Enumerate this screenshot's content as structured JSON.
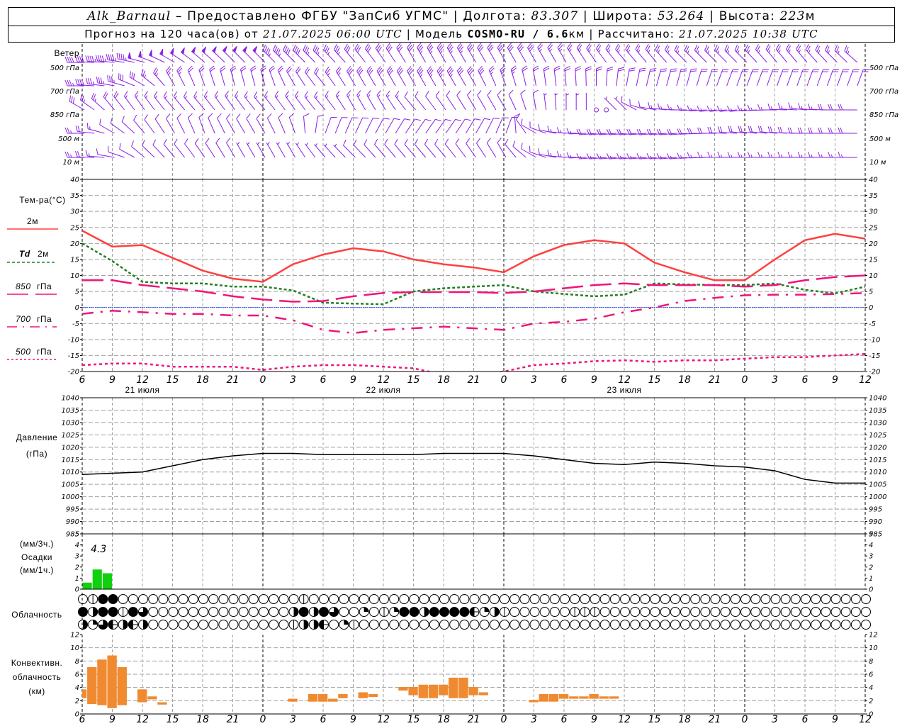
{
  "header": {
    "station": "Alk_Barnaul",
    "dash": "–",
    "provider": "Предоставлено ФГБУ \"ЗапСиб УГМС\"",
    "lon_label": "Долгота:",
    "lon": "83.307",
    "lat_label": "Широта:",
    "lat": "53.264",
    "alt_label": "Высота:",
    "alt": "223",
    "alt_unit": "м",
    "forecast_label": "Прогноз на 120 часа(ов) от",
    "forecast_start": "21.07.2025 06:00 UTC",
    "model_label": "Модель",
    "model": "COSMO-RU / 6.6",
    "model_unit": "км",
    "calc_label": "Рассчитано:",
    "calc_time": "21.07.2025 10:38 UTC",
    "sep": "|"
  },
  "labels": {
    "wind": "Ветер",
    "levels": [
      "500 гПа",
      "700 гПа",
      "850 гПа",
      "500 м",
      "10  м"
    ],
    "temp_title": "Тем-ра(°C)",
    "t2m": "2м",
    "td": "Td",
    "td_2m": "2м",
    "t850": "850",
    "t700": "700",
    "t500": "500",
    "gpa": "гПа",
    "pressure1": "Давление",
    "pressure2": "(гПа)",
    "precip1": "(мм/3ч.)",
    "precip2": "Осадки",
    "precip3": "(мм/1ч.)",
    "cloud": "Облачность",
    "conv1": "Конвективн.",
    "conv2": "облачность",
    "conv3": "(км)"
  },
  "colors": {
    "t2m": "#ff4040",
    "td": "#208020",
    "levels": "#f0147a",
    "zero": "#3050ff",
    "wind": "#8a1ee6",
    "precip": "#10d010",
    "conv": "#f08a30",
    "pressure": "#000000"
  },
  "axis": {
    "hour_ticks": [
      "6",
      "9",
      "12",
      "15",
      "18",
      "21",
      "0",
      "3",
      "6",
      "9",
      "12",
      "15",
      "18",
      "21",
      "0",
      "3",
      "6",
      "9",
      "12",
      "15",
      "18",
      "21",
      "0",
      "3",
      "6",
      "9",
      "12"
    ],
    "days": [
      "21 июля",
      "22 июля",
      "23 июля"
    ]
  },
  "chart_data": [
    {
      "type": "line",
      "title": "Тем-ра(°C)",
      "ylim": [
        -20,
        40
      ],
      "yticks": [
        "40",
        "35",
        "30",
        "25",
        "20",
        "15",
        "10",
        "5",
        "0",
        "-5",
        "-10",
        "-15",
        "-20"
      ],
      "grid": true,
      "times": [
        "21.07 06",
        "21.07 09",
        "21.07 12",
        "21.07 15",
        "21.07 18",
        "21.07 21",
        "22.07 00",
        "22.07 03",
        "22.07 06",
        "22.07 09",
        "22.07 12",
        "22.07 15",
        "22.07 18",
        "22.07 21",
        "23.07 00",
        "23.07 03",
        "23.07 06",
        "23.07 09",
        "23.07 12",
        "23.07 15",
        "23.07 18",
        "23.07 21",
        "24.07 00",
        "24.07 03",
        "24.07 06",
        "24.07 09",
        "24.07 12"
      ],
      "series": [
        {
          "name": "2м",
          "key": "t2m",
          "values": [
            24,
            19,
            19.5,
            15.5,
            11.5,
            9,
            8,
            13.5,
            16.5,
            18.5,
            17.5,
            15,
            13.5,
            12.5,
            11,
            16,
            19.5,
            21,
            20,
            14,
            11,
            8.5,
            8.5,
            15,
            21,
            23,
            21.5
          ]
        },
        {
          "name": "Td 2м",
          "key": "td",
          "values": [
            20,
            14.5,
            8,
            7.5,
            7.5,
            6.5,
            6.5,
            5.3,
            1.5,
            1.2,
            1,
            5,
            6,
            6.5,
            7,
            5,
            4.2,
            3.5,
            4,
            7.5,
            7.2,
            7,
            7,
            7.5,
            5.5,
            4.4,
            6.5
          ]
        },
        {
          "name": "850 гПа",
          "key": "t850",
          "values": [
            8.5,
            8.5,
            7,
            6,
            5,
            3.5,
            2.5,
            1.8,
            2,
            3.5,
            4.5,
            4.8,
            4.8,
            4.8,
            4.5,
            5,
            6,
            7,
            7.5,
            7,
            7,
            7,
            6.5,
            7,
            8.5,
            9.5,
            10
          ]
        },
        {
          "name": "700 гПа",
          "key": "t700",
          "values": [
            -2,
            -1,
            -1.5,
            -2,
            -2,
            -2.5,
            -2.5,
            -4,
            -7,
            -8,
            -7,
            -6.5,
            -6,
            -6.5,
            -7,
            -5,
            -4.5,
            -3.5,
            -1.5,
            0,
            2,
            3,
            3.8,
            4,
            4,
            4.2,
            4.5
          ]
        },
        {
          "name": "500 гПа",
          "key": "t500",
          "values": [
            -18,
            -17.5,
            -17.5,
            -18.5,
            -18.5,
            -18.5,
            -19.5,
            -18.5,
            -18,
            -18,
            -18.5,
            -19,
            -21,
            -21,
            -20,
            -18,
            -17.5,
            -16.8,
            -16.5,
            -17,
            -16.5,
            -16.5,
            -16,
            -15.5,
            -15.5,
            -15,
            -14.5
          ]
        }
      ]
    },
    {
      "type": "line",
      "title": "Давление (гПа)",
      "ylim": [
        985,
        1040
      ],
      "yticks": [
        "1040",
        "1035",
        "1030",
        "1025",
        "1020",
        "1015",
        "1010",
        "1005",
        "1000",
        "995",
        "990",
        "985"
      ],
      "grid": true,
      "series": [
        {
          "key": "pressure",
          "values": [
            1009,
            1009.5,
            1010,
            1012.5,
            1015,
            1016.5,
            1017.5,
            1017.5,
            1017,
            1017,
            1017,
            1017,
            1017.5,
            1017.5,
            1017.5,
            1016.5,
            1015,
            1013.5,
            1013,
            1014,
            1013.5,
            1012.5,
            1012,
            1010.5,
            1007,
            1005.5,
            1005.5
          ]
        }
      ]
    },
    {
      "type": "bar",
      "title": "Осадки",
      "ylim": [
        0,
        5
      ],
      "yticks": [
        "5",
        "4",
        "3",
        "2",
        "1",
        "0"
      ],
      "total_3h": "4.3",
      "bars": [
        {
          "time": "21.07 07",
          "value": 0.7
        },
        {
          "time": "21.07 08",
          "value": 2.1
        },
        {
          "time": "21.07 09",
          "value": 1.7
        }
      ]
    },
    {
      "type": "bar",
      "title": "Конвективн. облачность (км)",
      "ylim": [
        0,
        12
      ],
      "yticks": [
        "12",
        "10",
        "8",
        "6",
        "4",
        "2",
        "0"
      ],
      "bars": [
        {
          "time": "21.07 06",
          "base": 2.7,
          "top": 4.2
        },
        {
          "time": "21.07 07",
          "base": 1.7,
          "top": 8
        },
        {
          "time": "21.07 08",
          "base": 1.5,
          "top": 9.3
        },
        {
          "time": "21.07 09",
          "base": 1,
          "top": 10
        },
        {
          "time": "21.07 10",
          "base": 1.5,
          "top": 8
        },
        {
          "time": "21.07 12",
          "base": 2,
          "top": 4.2
        },
        {
          "time": "21.07 13",
          "base": 2.5,
          "top": 3
        },
        {
          "time": "21.07 14",
          "base": 1.6,
          "top": 2
        },
        {
          "time": "22.07 03",
          "base": 2.1,
          "top": 2.6
        },
        {
          "time": "22.07 05",
          "base": 2.1,
          "top": 3.4
        },
        {
          "time": "22.07 06",
          "base": 2.1,
          "top": 3.4
        },
        {
          "time": "22.07 07",
          "base": 2.1,
          "top": 2.6
        },
        {
          "time": "22.07 08",
          "base": 2.7,
          "top": 3.4
        },
        {
          "time": "22.07 10",
          "base": 2.7,
          "top": 3.7
        },
        {
          "time": "22.07 11",
          "base": 2.9,
          "top": 3.4
        },
        {
          "time": "22.07 14",
          "base": 4,
          "top": 4.6
        },
        {
          "time": "22.07 15",
          "base": 3.2,
          "top": 4.6
        },
        {
          "time": "22.07 16",
          "base": 2.7,
          "top": 5
        },
        {
          "time": "22.07 17",
          "base": 2.7,
          "top": 5
        },
        {
          "time": "22.07 18",
          "base": 3.2,
          "top": 5
        },
        {
          "time": "22.07 19",
          "base": 2.7,
          "top": 6.2
        },
        {
          "time": "22.07 20",
          "base": 2.7,
          "top": 6.2
        },
        {
          "time": "22.07 21",
          "base": 3.2,
          "top": 4.6
        },
        {
          "time": "22.07 22",
          "base": 3.2,
          "top": 3.7
        },
        {
          "time": "23.07 03",
          "base": 2,
          "top": 2.4
        },
        {
          "time": "23.07 04",
          "base": 2.1,
          "top": 3.4
        },
        {
          "time": "23.07 05",
          "base": 2.1,
          "top": 3.4
        },
        {
          "time": "23.07 06",
          "base": 2.6,
          "top": 3.4
        },
        {
          "time": "23.07 07",
          "base": 2.6,
          "top": 3
        },
        {
          "time": "23.07 08",
          "base": 2.6,
          "top": 3
        },
        {
          "time": "23.07 09",
          "base": 2.6,
          "top": 3.4
        },
        {
          "time": "23.07 10",
          "base": 2.6,
          "top": 3
        },
        {
          "time": "23.07 11",
          "base": 2.6,
          "top": 3
        }
      ]
    }
  ],
  "clouds": {
    "step_hours": 1,
    "legend": "o=0, v=1/8, q=1/4, h=1/2, H=1/2+, t=3/4, f=full",
    "rows": [
      "ovffoooooooooooooooooovoooooooooooooooooooooooooooooooooooooooooooooooooooooooo",
      "fhffvftoooooooooooooohfhftooqovqffhffffHqhvoooooovvvooooooooooooooooooooooooooo",
      "hqtHhHhoooooooooooooovhhHoqvooooooooooooooooooooooooooooooooooooooooooooooooooo"
    ]
  },
  "wind": {
    "unit": "м/с",
    "levels": [
      [
        [
          270,
          20
        ],
        [
          275,
          22
        ],
        [
          285,
          24
        ],
        [
          300,
          26
        ],
        [
          310,
          26
        ],
        [
          315,
          25
        ],
        [
          315,
          24
        ],
        [
          315,
          20
        ],
        [
          315,
          18
        ],
        [
          320,
          16
        ],
        [
          325,
          15
        ],
        [
          330,
          16
        ],
        [
          330,
          17
        ],
        [
          330,
          16
        ],
        [
          330,
          15
        ],
        [
          330,
          14
        ],
        [
          330,
          13
        ],
        [
          325,
          12
        ],
        [
          320,
          12
        ],
        [
          320,
          12
        ],
        [
          315,
          12
        ],
        [
          315,
          12
        ],
        [
          315,
          13
        ],
        [
          320,
          13
        ],
        [
          320,
          12
        ],
        [
          315,
          12
        ],
        [
          310,
          12
        ]
      ],
      [
        [
          270,
          18
        ],
        [
          280,
          18
        ],
        [
          300,
          14
        ],
        [
          330,
          12
        ],
        [
          340,
          10
        ],
        [
          345,
          10
        ],
        [
          345,
          10
        ],
        [
          330,
          10
        ],
        [
          320,
          10
        ],
        [
          330,
          14
        ],
        [
          330,
          15
        ],
        [
          330,
          16
        ],
        [
          330,
          17
        ],
        [
          330,
          15
        ],
        [
          340,
          12
        ],
        [
          350,
          10
        ],
        [
          355,
          10
        ],
        [
          0,
          9
        ],
        [
          10,
          9
        ],
        [
          15,
          9
        ],
        [
          15,
          9
        ],
        [
          20,
          9
        ],
        [
          20,
          9
        ],
        [
          20,
          10
        ],
        [
          20,
          10
        ],
        [
          20,
          10
        ],
        [
          20,
          10
        ]
      ],
      [
        [
          300,
          15
        ],
        [
          320,
          10
        ],
        [
          325,
          8
        ],
        [
          320,
          8
        ],
        [
          320,
          8
        ],
        [
          325,
          8
        ],
        [
          320,
          7
        ],
        [
          325,
          7
        ],
        [
          320,
          7
        ],
        [
          330,
          7
        ],
        [
          330,
          7
        ],
        [
          320,
          6
        ],
        [
          325,
          6
        ],
        [
          330,
          6
        ],
        [
          330,
          6
        ],
        [
          350,
          4
        ],
        [
          0,
          3
        ],
        [
          0,
          0
        ],
        [
          315,
          3
        ],
        [
          280,
          6
        ],
        [
          270,
          7
        ],
        [
          265,
          8
        ],
        [
          265,
          8
        ],
        [
          270,
          8
        ],
        [
          275,
          8
        ],
        [
          270,
          9
        ],
        [
          270,
          9
        ]
      ],
      [
        [
          270,
          12
        ],
        [
          300,
          6
        ],
        [
          320,
          5
        ],
        [
          330,
          5
        ],
        [
          340,
          5
        ],
        [
          330,
          5
        ],
        [
          330,
          5
        ],
        [
          340,
          5
        ],
        [
          20,
          6
        ],
        [
          25,
          6
        ],
        [
          30,
          5
        ],
        [
          35,
          5
        ],
        [
          35,
          5
        ],
        [
          30,
          5
        ],
        [
          20,
          5
        ],
        [
          300,
          5
        ],
        [
          275,
          7
        ],
        [
          265,
          9
        ],
        [
          265,
          9
        ],
        [
          265,
          9
        ],
        [
          265,
          9
        ],
        [
          270,
          9
        ],
        [
          275,
          9
        ],
        [
          275,
          9
        ],
        [
          270,
          9
        ],
        [
          270,
          9
        ],
        [
          270,
          9
        ]
      ],
      [
        [
          270,
          12
        ],
        [
          280,
          5
        ],
        [
          310,
          4
        ],
        [
          320,
          4
        ],
        [
          325,
          4
        ],
        [
          330,
          4
        ],
        [
          330,
          3
        ],
        [
          330,
          3
        ],
        [
          320,
          3
        ],
        [
          315,
          4
        ],
        [
          320,
          4
        ],
        [
          320,
          4
        ],
        [
          320,
          4
        ],
        [
          325,
          4
        ],
        [
          330,
          4
        ],
        [
          300,
          4
        ],
        [
          275,
          7
        ],
        [
          265,
          8
        ],
        [
          265,
          8
        ],
        [
          265,
          8
        ],
        [
          265,
          8
        ],
        [
          270,
          8
        ],
        [
          270,
          8
        ],
        [
          270,
          8
        ],
        [
          270,
          7
        ],
        [
          270,
          7
        ],
        [
          270,
          7
        ]
      ]
    ]
  }
}
